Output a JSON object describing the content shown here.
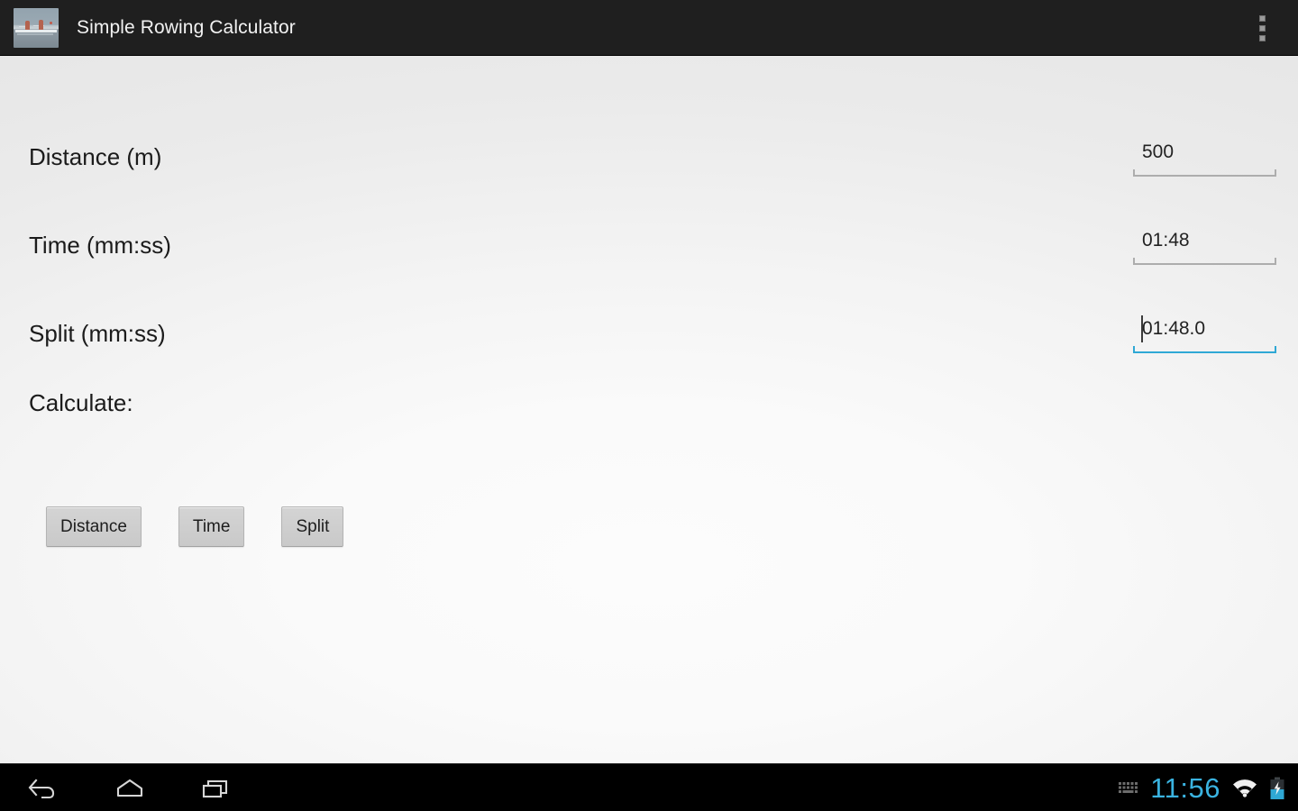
{
  "action_bar": {
    "title": "Simple Rowing Calculator",
    "app_icon_name": "rowing-boat-photo-icon",
    "overflow_menu_name": "overflow-menu-icon"
  },
  "form": {
    "fields": [
      {
        "label": "Distance (m)",
        "value": "500",
        "focused": false,
        "underline_color": "#adadad"
      },
      {
        "label": "Time (mm:ss)",
        "value": "01:48",
        "focused": false,
        "underline_color": "#adadad"
      },
      {
        "label": "Split (mm:ss)",
        "value": "01:48.0",
        "focused": true,
        "underline_color": "#2fa8d5"
      }
    ],
    "calculate_label": "Calculate:",
    "buttons": [
      {
        "label": "Distance"
      },
      {
        "label": "Time"
      },
      {
        "label": "Split"
      }
    ]
  },
  "nav_bar": {
    "buttons": [
      {
        "name": "back-icon"
      },
      {
        "name": "home-icon"
      },
      {
        "name": "recents-icon"
      }
    ],
    "status": {
      "keyboard_icon": "keyboard-icon",
      "clock": "11:56",
      "wifi_icon": "wifi-icon",
      "battery_icon": "battery-charging-icon"
    }
  },
  "colors": {
    "action_bar_bg": "#1f1f1f",
    "content_bg": "#ebebeb",
    "accent_blue": "#33b5e5",
    "clock_blue": "#3ab3e0",
    "button_face": "#cecece",
    "text_primary": "#1b1b1b"
  }
}
